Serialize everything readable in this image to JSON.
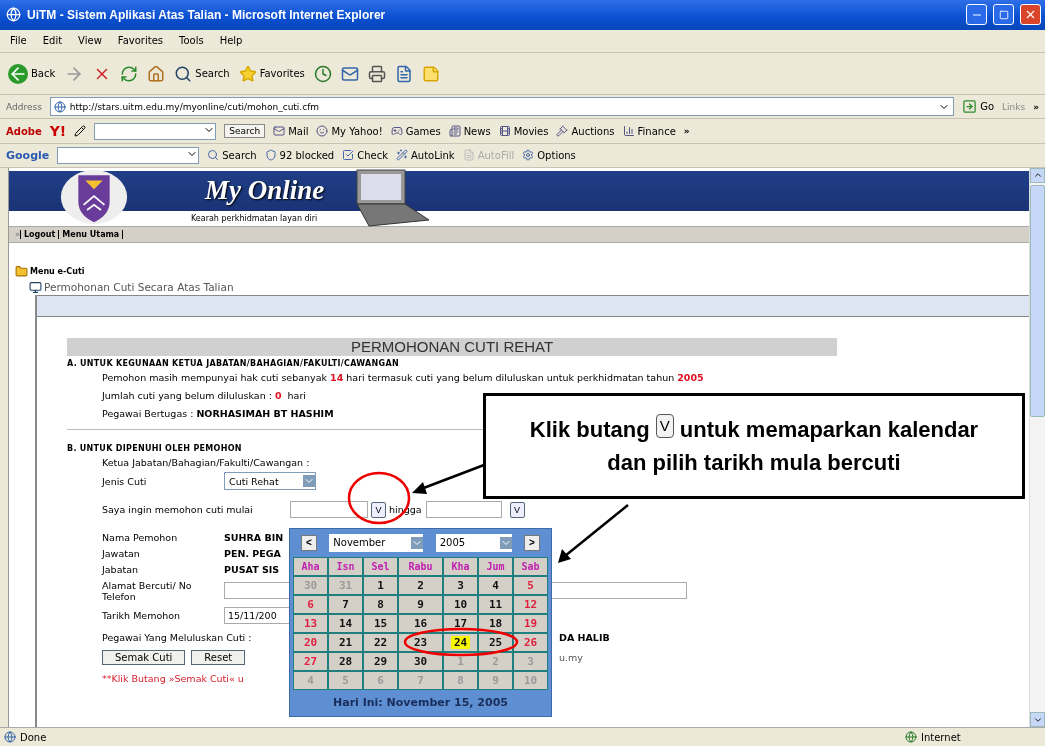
{
  "window": {
    "title": "UiTM - Sistem Aplikasi Atas Talian - Microsoft Internet Explorer"
  },
  "menu": [
    "File",
    "Edit",
    "View",
    "Favorites",
    "Tools",
    "Help"
  ],
  "toolbar": {
    "back": "Back",
    "search": "Search",
    "favorites": "Favorites"
  },
  "address": {
    "label": "Address",
    "url": "http://stars.uitm.edu.my/myonline/cuti/mohon_cuti.cfm",
    "go": "Go",
    "links": "Links",
    "links_more": "»"
  },
  "yahoo_toolbar": {
    "brand": "Adobe",
    "yahoo": "Y!",
    "search": "Search",
    "items": [
      "Mail",
      "My Yahoo!",
      "Games",
      "News",
      "Movies",
      "Auctions",
      "Finance"
    ],
    "more": "»"
  },
  "google_toolbar": {
    "brand": "Google",
    "items": [
      {
        "label": "Search",
        "disabled": false
      },
      {
        "label": "92 blocked",
        "disabled": false
      },
      {
        "label": "Check",
        "disabled": false
      },
      {
        "label": "AutoLink",
        "disabled": false
      },
      {
        "label": "AutoFill",
        "disabled": true
      },
      {
        "label": "Options",
        "disabled": false
      }
    ]
  },
  "site": {
    "title": "My Online",
    "tagline": "Kearah perkhidmatan layan diri",
    "nav_mark": "»",
    "nav": [
      "Logout",
      "Menu Utama"
    ]
  },
  "tree": {
    "label": "Menu e-Cuti",
    "children": [
      {
        "label": "Permohonan Cuti Secara Atas Talian"
      }
    ]
  },
  "form": {
    "heading": "PERMOHONAN CUTI REHAT",
    "section_a": {
      "title": "A. UNTUK KEGUNAAN KETUA JABATAN/BAHAGIAN/FAKULTI/CAWANGAN",
      "lines": [
        [
          {
            "text": "Pemohon masih mempunyai hak cuti sebanyak ",
            "kind": "plain"
          },
          {
            "text": "14",
            "kind": "red"
          },
          {
            "text": " hari termasuk cuti yang belum diluluskan untuk perkhidmatan tahun ",
            "kind": "plain"
          },
          {
            "text": "2005",
            "kind": "red"
          }
        ],
        [
          {
            "text": "Jumlah cuti yang belum diluluskan : ",
            "kind": "plain"
          },
          {
            "text": "0",
            "kind": "red"
          },
          {
            "text": "  hari",
            "kind": "plain"
          }
        ],
        [
          {
            "text": "Pegawai Bertugas : ",
            "kind": "plain"
          },
          {
            "text": "NORHASIMAH BT HASHIM",
            "kind": "bold"
          }
        ]
      ]
    },
    "section_b": {
      "title": "B. UNTUK DIPENUHI OLEH PEMOHON",
      "head_label": "Ketua Jabatan/Bahagian/Fakulti/Cawangan :",
      "leave_type": {
        "label": "Jenis Cuti",
        "value": "Cuti Rehat"
      },
      "dates": {
        "label": "Saya ingin memohon cuti mulai",
        "picker_start": "V",
        "until": "hingga",
        "picker_end": "V"
      },
      "info": [
        {
          "label": "Nama Pemohon",
          "value": "SUHRA BIN"
        },
        {
          "label": "Jawatan",
          "value": "PEN. PEGA"
        },
        {
          "label": "Jabatan",
          "value": "PUSAT SIS"
        }
      ],
      "address": {
        "label": "Alamat Bercuti/ No Telefon"
      },
      "apply_date": {
        "label": "Tarikh Memohon",
        "value": "15/11/200"
      },
      "approver": {
        "label": "Pegawai Yang Meluluskan Cuti :",
        "value": "DA HALIB",
        "email": "u.my"
      },
      "buttons": [
        "Semak Cuti",
        "Reset"
      ],
      "note": "**Klik Butang »Semak Cuti« u"
    }
  },
  "calendar": {
    "prev": "<",
    "next": ">",
    "month": "November",
    "year": "2005",
    "weekdays": [
      "Aha",
      "Isn",
      "Sel",
      "Rabu",
      "Kha",
      "Jum",
      "Sab"
    ],
    "weeks": [
      [
        {
          "day": "30",
          "kind": "other",
          "selected": false
        },
        {
          "day": "31",
          "kind": "other",
          "selected": false
        },
        {
          "day": "1",
          "kind": "weekday",
          "selected": false
        },
        {
          "day": "2",
          "kind": "weekday",
          "selected": false
        },
        {
          "day": "3",
          "kind": "weekday",
          "selected": false
        },
        {
          "day": "4",
          "kind": "weekday",
          "selected": false
        },
        {
          "day": "5",
          "kind": "weekend",
          "selected": false
        }
      ],
      [
        {
          "day": "6",
          "kind": "weekend",
          "selected": false
        },
        {
          "day": "7",
          "kind": "weekday",
          "selected": false
        },
        {
          "day": "8",
          "kind": "weekday",
          "selected": false
        },
        {
          "day": "9",
          "kind": "weekday",
          "selected": false
        },
        {
          "day": "10",
          "kind": "weekday",
          "selected": false
        },
        {
          "day": "11",
          "kind": "weekday",
          "selected": false
        },
        {
          "day": "12",
          "kind": "weekend",
          "selected": false
        }
      ],
      [
        {
          "day": "13",
          "kind": "weekend",
          "selected": false
        },
        {
          "day": "14",
          "kind": "weekday",
          "selected": false
        },
        {
          "day": "15",
          "kind": "weekday",
          "selected": false
        },
        {
          "day": "16",
          "kind": "weekday",
          "selected": false
        },
        {
          "day": "17",
          "kind": "weekday",
          "selected": false
        },
        {
          "day": "18",
          "kind": "weekday",
          "selected": false
        },
        {
          "day": "19",
          "kind": "weekend",
          "selected": false
        }
      ],
      [
        {
          "day": "20",
          "kind": "weekend",
          "selected": false
        },
        {
          "day": "21",
          "kind": "weekday",
          "selected": false
        },
        {
          "day": "22",
          "kind": "weekday",
          "selected": false
        },
        {
          "day": "23",
          "kind": "weekday",
          "selected": false
        },
        {
          "day": "24",
          "kind": "weekday",
          "selected": true
        },
        {
          "day": "25",
          "kind": "weekday",
          "selected": false
        },
        {
          "day": "26",
          "kind": "weekend",
          "selected": false
        }
      ],
      [
        {
          "day": "27",
          "kind": "weekend",
          "selected": false
        },
        {
          "day": "28",
          "kind": "weekday",
          "selected": false
        },
        {
          "day": "29",
          "kind": "weekday",
          "selected": false
        },
        {
          "day": "30",
          "kind": "weekday",
          "selected": false
        },
        {
          "day": "1",
          "kind": "other",
          "selected": false
        },
        {
          "day": "2",
          "kind": "other",
          "selected": false
        },
        {
          "day": "3",
          "kind": "other",
          "selected": false
        }
      ],
      [
        {
          "day": "4",
          "kind": "other",
          "selected": false
        },
        {
          "day": "5",
          "kind": "other",
          "selected": false
        },
        {
          "day": "6",
          "kind": "other",
          "selected": false
        },
        {
          "day": "7",
          "kind": "other",
          "selected": false
        },
        {
          "day": "8",
          "kind": "other",
          "selected": false
        },
        {
          "day": "9",
          "kind": "other",
          "selected": false
        },
        {
          "day": "10",
          "kind": "other",
          "selected": false
        }
      ]
    ],
    "today": "Hari Ini:  November 15,  2005"
  },
  "callout": {
    "before": "Klik butang",
    "key": "V",
    "after": "untuk memaparkan kalendar dan pilih tarikh mula bercuti"
  },
  "status_bar": {
    "text": "Done",
    "zone": "Internet"
  }
}
